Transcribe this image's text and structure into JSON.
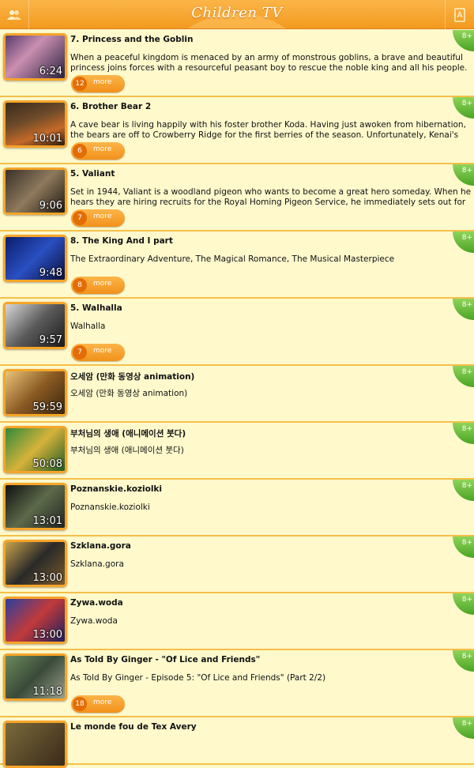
{
  "header": {
    "title": "Children TV"
  },
  "videos": [
    {
      "title": "7. Princess and the Goblin",
      "description": "When a peaceful kingdom is menaced by an army of monstrous goblins, a brave and beautiful princess joins forces with a resourceful peasant boy to rescue the noble king and all his people. The lucky pair must battle t...",
      "duration": "6:24",
      "count": "12",
      "more_label": "more",
      "age": "8+"
    },
    {
      "title": "6. Brother Bear 2",
      "description": "A cave bear is living happily with his foster brother Koda. Having just awoken from hibernation, the bears are off to Crowberry Ridge for the first berries of the season. Unfortunately, Kenai's haunted by memories of his...",
      "duration": "10:01",
      "count": "6",
      "more_label": "more",
      "age": "8+"
    },
    {
      "title": "5. Valiant",
      "description": "Set in 1944, Valiant is a woodland pigeon who wants to become a great hero someday. When he hears they are hiring recruits for the Royal Homing Pigeon Service, he immediately sets out for London.",
      "duration": "9:06",
      "count": "7",
      "more_label": "more",
      "age": "8+"
    },
    {
      "title": "8. The King And I part",
      "description": "The Extraordinary Adventure, The Magical Romance, The Musical Masterpiece",
      "duration": "9:48",
      "count": "8",
      "more_label": "more",
      "age": "8+"
    },
    {
      "title": "5. Walhalla",
      "description": "Walhalla",
      "duration": "9:57",
      "count": "7",
      "more_label": "more",
      "age": "8+"
    },
    {
      "title": "오세암 (만화 동영상 animation)",
      "description": "오세암 (만화 동영상 animation)",
      "duration": "59:59",
      "age": "8+"
    },
    {
      "title": "부처님의 생애 (애니메이션 붓다)",
      "description": "부처님의 생애 (애니메이션 붓다)",
      "duration": "50:08",
      "age": "8+"
    },
    {
      "title": "Poznanskie.koziolki",
      "description": "Poznanskie.koziolki",
      "duration": "13:01",
      "age": "8+"
    },
    {
      "title": "Szklana.gora",
      "description": "Szklana.gora",
      "duration": "13:00",
      "age": "8+"
    },
    {
      "title": "Zywa.woda",
      "description": "Zywa.woda",
      "duration": "13:00",
      "age": "8+"
    },
    {
      "title": "As Told By Ginger - \"Of Lice and Friends\"",
      "description": "As Told By Ginger - Episode 5: \"Of Lice and Friends\" (Part 2/2)",
      "duration": "11:18",
      "count": "18",
      "more_label": "more",
      "age": "8+"
    },
    {
      "title": "Le monde fou de Tex Avery",
      "description": "",
      "duration": "",
      "age": "8+"
    }
  ],
  "colors": {
    "header": "#f39a1f",
    "background": "#fff9cc",
    "accent": "#f6a52a",
    "age_badge": "#5cb52e"
  },
  "icons": {
    "header_left": "users-icon",
    "header_right": "book-icon"
  }
}
